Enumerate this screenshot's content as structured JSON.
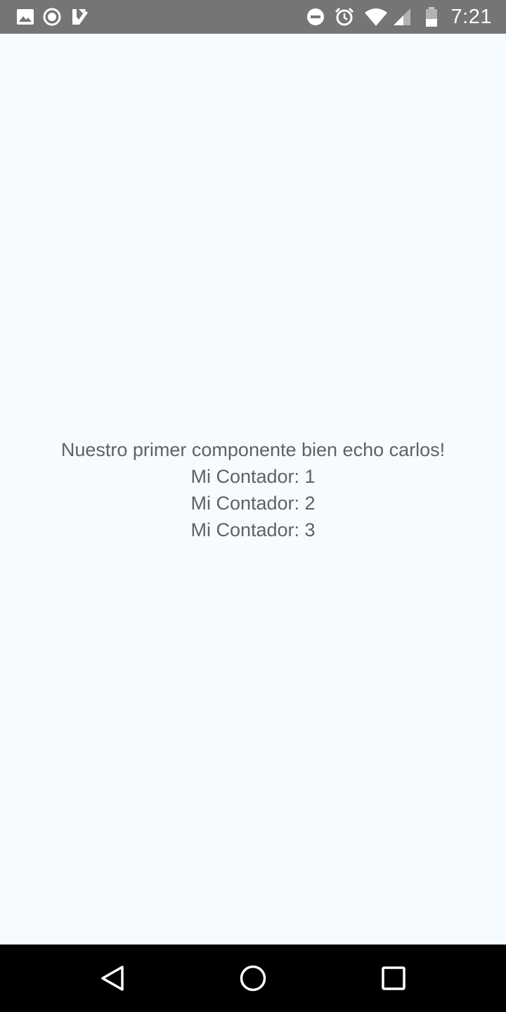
{
  "status_bar": {
    "time": "7:21",
    "icons": [
      "image-icon",
      "record-icon",
      "check-flag-icon",
      "do-not-disturb-icon",
      "alarm-icon",
      "wifi-icon",
      "signal-icon",
      "battery-icon"
    ],
    "background_color": "#757575"
  },
  "main": {
    "background_color": "#f5fbfe",
    "text_color": "#5f6266",
    "heading": "Nuestro primer componente bien echo carlos!",
    "counters": [
      {
        "label": "Mi Contador: 1"
      },
      {
        "label": "Mi Contador: 2"
      },
      {
        "label": "Mi Contador: 3"
      }
    ]
  },
  "nav_bar": {
    "buttons": [
      "back-icon",
      "home-icon",
      "recents-icon"
    ],
    "background_color": "#000000"
  }
}
